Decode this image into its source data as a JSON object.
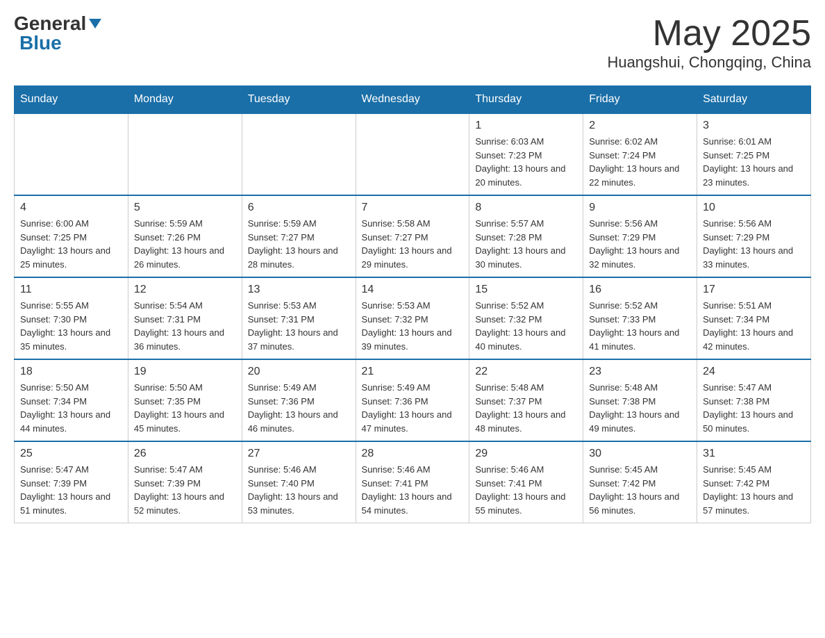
{
  "logo": {
    "general": "General",
    "blue": "Blue"
  },
  "title": "May 2025",
  "subtitle": "Huangshui, Chongqing, China",
  "weekdays": [
    "Sunday",
    "Monday",
    "Tuesday",
    "Wednesday",
    "Thursday",
    "Friday",
    "Saturday"
  ],
  "weeks": [
    [
      {
        "day": "",
        "info": ""
      },
      {
        "day": "",
        "info": ""
      },
      {
        "day": "",
        "info": ""
      },
      {
        "day": "",
        "info": ""
      },
      {
        "day": "1",
        "info": "Sunrise: 6:03 AM\nSunset: 7:23 PM\nDaylight: 13 hours and 20 minutes."
      },
      {
        "day": "2",
        "info": "Sunrise: 6:02 AM\nSunset: 7:24 PM\nDaylight: 13 hours and 22 minutes."
      },
      {
        "day": "3",
        "info": "Sunrise: 6:01 AM\nSunset: 7:25 PM\nDaylight: 13 hours and 23 minutes."
      }
    ],
    [
      {
        "day": "4",
        "info": "Sunrise: 6:00 AM\nSunset: 7:25 PM\nDaylight: 13 hours and 25 minutes."
      },
      {
        "day": "5",
        "info": "Sunrise: 5:59 AM\nSunset: 7:26 PM\nDaylight: 13 hours and 26 minutes."
      },
      {
        "day": "6",
        "info": "Sunrise: 5:59 AM\nSunset: 7:27 PM\nDaylight: 13 hours and 28 minutes."
      },
      {
        "day": "7",
        "info": "Sunrise: 5:58 AM\nSunset: 7:27 PM\nDaylight: 13 hours and 29 minutes."
      },
      {
        "day": "8",
        "info": "Sunrise: 5:57 AM\nSunset: 7:28 PM\nDaylight: 13 hours and 30 minutes."
      },
      {
        "day": "9",
        "info": "Sunrise: 5:56 AM\nSunset: 7:29 PM\nDaylight: 13 hours and 32 minutes."
      },
      {
        "day": "10",
        "info": "Sunrise: 5:56 AM\nSunset: 7:29 PM\nDaylight: 13 hours and 33 minutes."
      }
    ],
    [
      {
        "day": "11",
        "info": "Sunrise: 5:55 AM\nSunset: 7:30 PM\nDaylight: 13 hours and 35 minutes."
      },
      {
        "day": "12",
        "info": "Sunrise: 5:54 AM\nSunset: 7:31 PM\nDaylight: 13 hours and 36 minutes."
      },
      {
        "day": "13",
        "info": "Sunrise: 5:53 AM\nSunset: 7:31 PM\nDaylight: 13 hours and 37 minutes."
      },
      {
        "day": "14",
        "info": "Sunrise: 5:53 AM\nSunset: 7:32 PM\nDaylight: 13 hours and 39 minutes."
      },
      {
        "day": "15",
        "info": "Sunrise: 5:52 AM\nSunset: 7:32 PM\nDaylight: 13 hours and 40 minutes."
      },
      {
        "day": "16",
        "info": "Sunrise: 5:52 AM\nSunset: 7:33 PM\nDaylight: 13 hours and 41 minutes."
      },
      {
        "day": "17",
        "info": "Sunrise: 5:51 AM\nSunset: 7:34 PM\nDaylight: 13 hours and 42 minutes."
      }
    ],
    [
      {
        "day": "18",
        "info": "Sunrise: 5:50 AM\nSunset: 7:34 PM\nDaylight: 13 hours and 44 minutes."
      },
      {
        "day": "19",
        "info": "Sunrise: 5:50 AM\nSunset: 7:35 PM\nDaylight: 13 hours and 45 minutes."
      },
      {
        "day": "20",
        "info": "Sunrise: 5:49 AM\nSunset: 7:36 PM\nDaylight: 13 hours and 46 minutes."
      },
      {
        "day": "21",
        "info": "Sunrise: 5:49 AM\nSunset: 7:36 PM\nDaylight: 13 hours and 47 minutes."
      },
      {
        "day": "22",
        "info": "Sunrise: 5:48 AM\nSunset: 7:37 PM\nDaylight: 13 hours and 48 minutes."
      },
      {
        "day": "23",
        "info": "Sunrise: 5:48 AM\nSunset: 7:38 PM\nDaylight: 13 hours and 49 minutes."
      },
      {
        "day": "24",
        "info": "Sunrise: 5:47 AM\nSunset: 7:38 PM\nDaylight: 13 hours and 50 minutes."
      }
    ],
    [
      {
        "day": "25",
        "info": "Sunrise: 5:47 AM\nSunset: 7:39 PM\nDaylight: 13 hours and 51 minutes."
      },
      {
        "day": "26",
        "info": "Sunrise: 5:47 AM\nSunset: 7:39 PM\nDaylight: 13 hours and 52 minutes."
      },
      {
        "day": "27",
        "info": "Sunrise: 5:46 AM\nSunset: 7:40 PM\nDaylight: 13 hours and 53 minutes."
      },
      {
        "day": "28",
        "info": "Sunrise: 5:46 AM\nSunset: 7:41 PM\nDaylight: 13 hours and 54 minutes."
      },
      {
        "day": "29",
        "info": "Sunrise: 5:46 AM\nSunset: 7:41 PM\nDaylight: 13 hours and 55 minutes."
      },
      {
        "day": "30",
        "info": "Sunrise: 5:45 AM\nSunset: 7:42 PM\nDaylight: 13 hours and 56 minutes."
      },
      {
        "day": "31",
        "info": "Sunrise: 5:45 AM\nSunset: 7:42 PM\nDaylight: 13 hours and 57 minutes."
      }
    ]
  ]
}
